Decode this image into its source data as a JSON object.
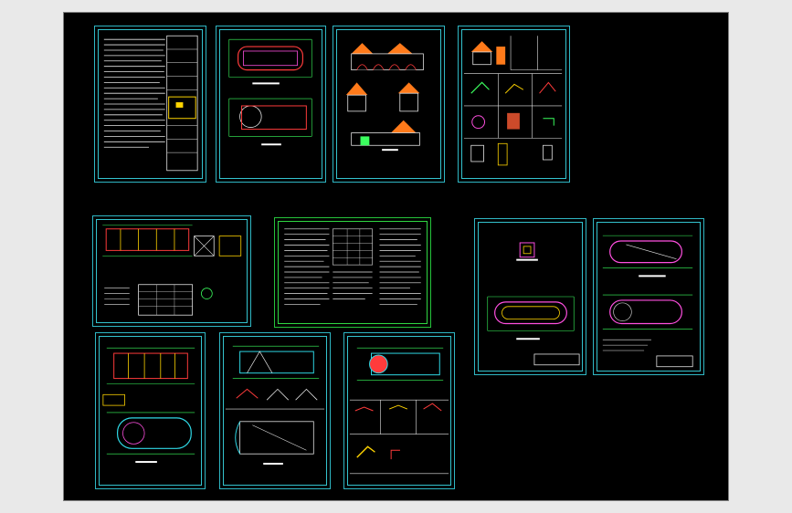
{
  "viewer": {
    "background_color": "#000000",
    "frame_color": "#2fb7c4",
    "accent_colors": [
      "#ff3b3b",
      "#ffd400",
      "#3bff5e",
      "#ff4fe0",
      "#ffffff",
      "#2fd9e6"
    ]
  },
  "sheets": [
    {
      "id": "s1",
      "kind": "text-notes",
      "frame": "cyan"
    },
    {
      "id": "s2",
      "kind": "plan-pair",
      "frame": "cyan"
    },
    {
      "id": "s3",
      "kind": "elevations",
      "frame": "cyan"
    },
    {
      "id": "s4",
      "kind": "details",
      "frame": "cyan"
    },
    {
      "id": "s5",
      "kind": "structure-plan",
      "frame": "cyan"
    },
    {
      "id": "s6",
      "kind": "text-notes-wide",
      "frame": "green"
    },
    {
      "id": "s7",
      "kind": "oval-plan",
      "frame": "cyan"
    },
    {
      "id": "s8",
      "kind": "oval-plan-pair",
      "frame": "cyan"
    },
    {
      "id": "s9",
      "kind": "plan-pair-b",
      "frame": "cyan"
    },
    {
      "id": "s10",
      "kind": "roof-plan",
      "frame": "cyan"
    },
    {
      "id": "s11",
      "kind": "detail-grid",
      "frame": "cyan"
    }
  ]
}
